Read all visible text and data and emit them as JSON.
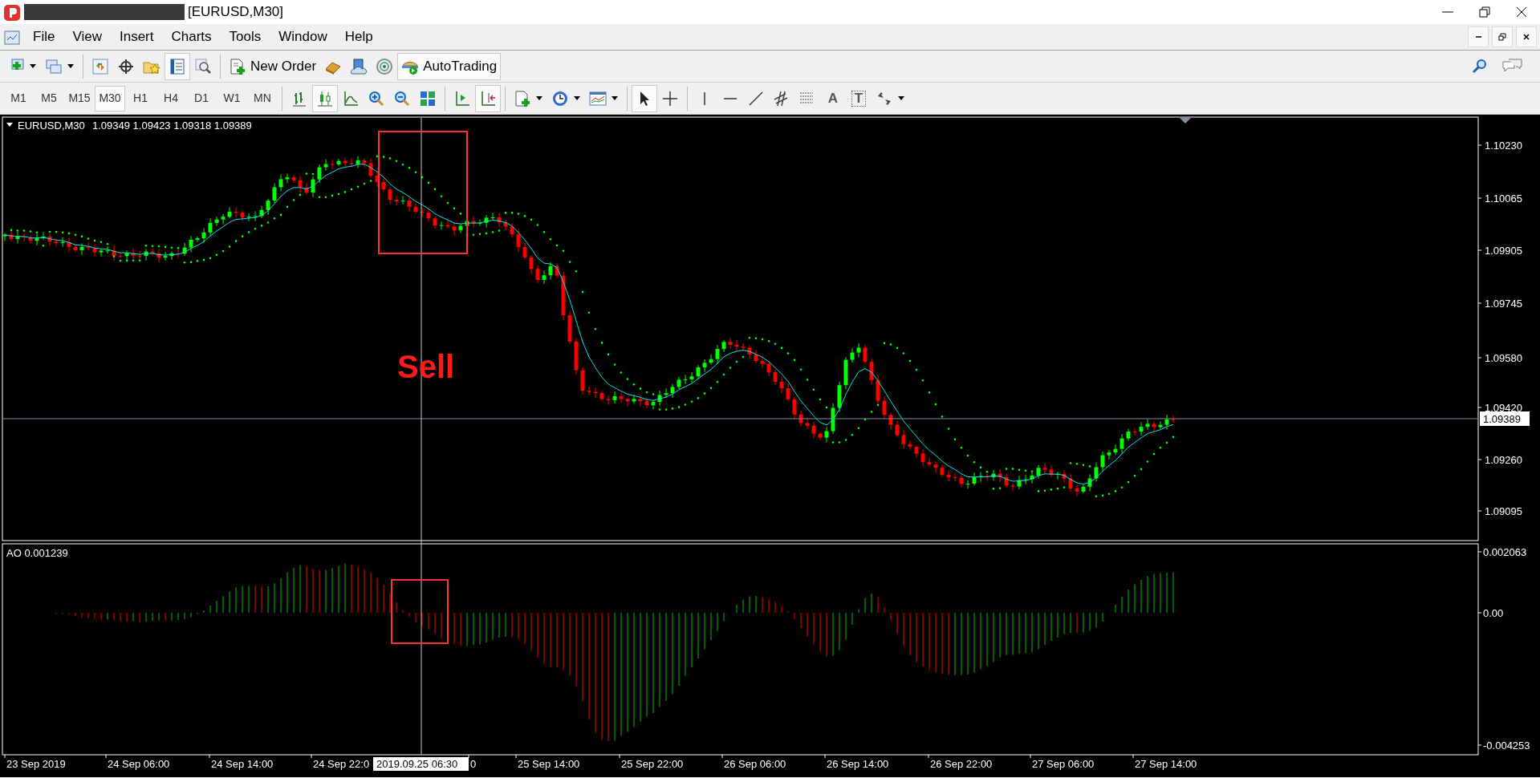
{
  "window": {
    "title": "[EURUSD,M30]"
  },
  "menu": [
    "File",
    "View",
    "Insert",
    "Charts",
    "Tools",
    "Window",
    "Help"
  ],
  "standard_toolbar": {
    "new_order": "New Order",
    "autotrading": "AutoTrading",
    "data_window_pressed": true
  },
  "timeframes": [
    {
      "label": "M1",
      "selected": false
    },
    {
      "label": "M5",
      "selected": false
    },
    {
      "label": "M15",
      "selected": false
    },
    {
      "label": "M30",
      "selected": true
    },
    {
      "label": "H1",
      "selected": false
    },
    {
      "label": "H4",
      "selected": false
    },
    {
      "label": "D1",
      "selected": false
    },
    {
      "label": "W1",
      "selected": false
    },
    {
      "label": "MN",
      "selected": false
    }
  ],
  "charts_toolbar": {
    "bar_chart_selected": false,
    "candlesticks_selected": true,
    "line_chart_selected": false,
    "auto_scroll_pressed": false,
    "chart_shift_pressed": true,
    "cursor_selected": true,
    "crosshair_selected": false,
    "text_tool": "A",
    "label_tool": "T"
  },
  "chart": {
    "symbol": "EURUSD,M30",
    "ohlc": "1.09349 1.09423 1.09318 1.09389",
    "price_ticks": [
      "1.10230",
      "1.10065",
      "1.09905",
      "1.09745",
      "1.09580",
      "1.09420",
      "1.09260",
      "1.09095"
    ],
    "current_price": "1.09389",
    "annotation": "Sell",
    "indicator_label": "AO 0.001239",
    "indicator_ticks": [
      "0.002063",
      "0.00",
      "-0.004253"
    ],
    "time_labels": [
      "23 Sep 2019",
      "24 Sep 06:00",
      "24 Sep 14:00",
      "24 Sep 22:0",
      "0",
      "25 Sep 14:00",
      "25 Sep 22:00",
      "26 Sep 06:00",
      "26 Sep 14:00",
      "26 Sep 22:00",
      "27 Sep 06:00",
      "27 Sep 14:00"
    ],
    "crosshair_time": "2019.09.25 06:30"
  }
}
